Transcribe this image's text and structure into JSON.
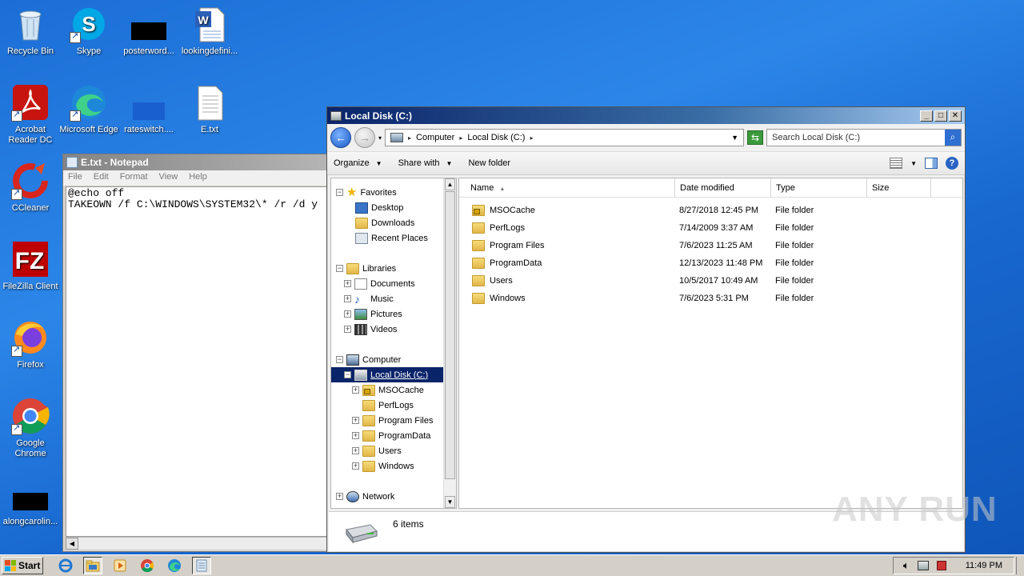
{
  "desktop": {
    "icons": [
      {
        "label": "Recycle Bin"
      },
      {
        "label": "Skype"
      },
      {
        "label": "posterword..."
      },
      {
        "label": "lookingdefini..."
      },
      {
        "label": "Acrobat Reader DC"
      },
      {
        "label": "Microsoft Edge"
      },
      {
        "label": "rateswitch...."
      },
      {
        "label": "E.txt"
      },
      {
        "label": "CCleaner"
      },
      {
        "label": "FileZilla Client"
      },
      {
        "label": "Firefox"
      },
      {
        "label": "Google Chrome"
      },
      {
        "label": "alongcarolin..."
      }
    ]
  },
  "notepad": {
    "title": "E.txt - Notepad",
    "menu": [
      "File",
      "Edit",
      "Format",
      "View",
      "Help"
    ],
    "content": "@echo off\nTAKEOWN /f C:\\WINDOWS\\SYSTEM32\\* /r /d y"
  },
  "explorer": {
    "title": "Local Disk (C:)",
    "address": {
      "crumbs": [
        "Computer",
        "Local Disk (C:)"
      ]
    },
    "search_placeholder": "Search Local Disk (C:)",
    "toolbar": {
      "organize": "Organize",
      "share_with": "Share with",
      "new_folder": "New folder"
    },
    "nav": {
      "favorites": "Favorites",
      "favorites_items": [
        "Desktop",
        "Downloads",
        "Recent Places"
      ],
      "libraries": "Libraries",
      "libraries_items": [
        "Documents",
        "Music",
        "Pictures",
        "Videos"
      ],
      "computer": "Computer",
      "local_disk": "Local Disk (C:)",
      "disk_items": [
        "MSOCache",
        "PerfLogs",
        "Program Files",
        "ProgramData",
        "Users",
        "Windows"
      ],
      "network": "Network"
    },
    "columns": [
      "Name",
      "Date modified",
      "Type",
      "Size"
    ],
    "files": [
      {
        "name": "MSOCache",
        "date": "8/27/2018 12:45 PM",
        "type": "File folder",
        "locked": true
      },
      {
        "name": "PerfLogs",
        "date": "7/14/2009 3:37 AM",
        "type": "File folder",
        "locked": false
      },
      {
        "name": "Program Files",
        "date": "7/6/2023 11:25 AM",
        "type": "File folder",
        "locked": false
      },
      {
        "name": "ProgramData",
        "date": "12/13/2023 11:48 PM",
        "type": "File folder",
        "locked": false
      },
      {
        "name": "Users",
        "date": "10/5/2017 10:49 AM",
        "type": "File folder",
        "locked": false
      },
      {
        "name": "Windows",
        "date": "7/6/2023 5:31 PM",
        "type": "File folder",
        "locked": false
      }
    ],
    "status": "6 items"
  },
  "taskbar": {
    "start_label": "Start",
    "clock": "11:49 PM"
  },
  "watermark": "ANY RUN"
}
